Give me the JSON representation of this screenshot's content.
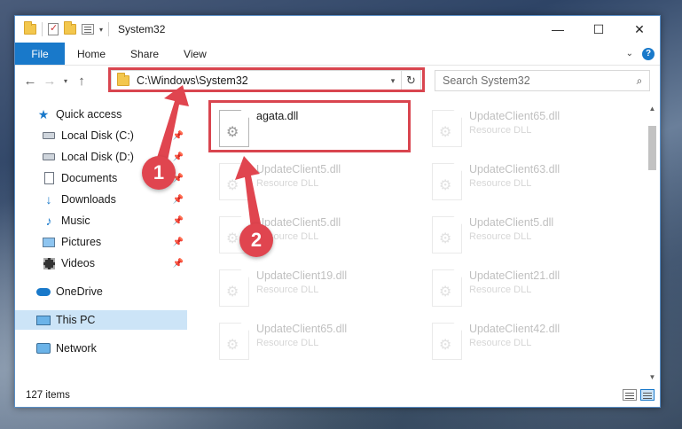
{
  "window": {
    "title": "System32",
    "controls": {
      "minimize": "—",
      "maximize": "☐",
      "close": "✕"
    }
  },
  "ribbon": {
    "tabs": [
      {
        "label": "File",
        "active": true
      },
      {
        "label": "Home"
      },
      {
        "label": "Share"
      },
      {
        "label": "View"
      }
    ],
    "expand_icon": "chevron-down-icon",
    "help_icon": "?"
  },
  "nav": {
    "back": "←",
    "forward": "→",
    "recent": "▾",
    "up": "↑",
    "address": "C:\\Windows\\System32",
    "address_dropdown": "▾",
    "refresh": "↻",
    "search_placeholder": "Search System32",
    "search_icon": "⌕"
  },
  "sidebar": {
    "items": [
      {
        "label": "Quick access",
        "icon": "star-icon",
        "level": "top",
        "pinned": false
      },
      {
        "label": "Local Disk (C:)",
        "icon": "disk-icon",
        "level": "sub",
        "pinned": true
      },
      {
        "label": "Local Disk (D:)",
        "icon": "disk-icon",
        "level": "sub",
        "pinned": true
      },
      {
        "label": "Documents",
        "icon": "document-icon",
        "level": "sub",
        "pinned": true
      },
      {
        "label": "Downloads",
        "icon": "download-icon",
        "level": "sub",
        "pinned": true
      },
      {
        "label": "Music",
        "icon": "music-icon",
        "level": "sub",
        "pinned": true
      },
      {
        "label": "Pictures",
        "icon": "pictures-icon",
        "level": "sub",
        "pinned": true
      },
      {
        "label": "Videos",
        "icon": "videos-icon",
        "level": "sub",
        "pinned": true
      },
      {
        "label": "OneDrive",
        "icon": "cloud-icon",
        "level": "top",
        "pinned": false
      },
      {
        "label": "This PC",
        "icon": "computer-icon",
        "level": "top",
        "pinned": false,
        "selected": true
      },
      {
        "label": "Network",
        "icon": "network-icon",
        "level": "top",
        "pinned": false
      }
    ],
    "pin_glyph": "📌"
  },
  "files": [
    {
      "name": "agata.dll",
      "type": "",
      "faded": false
    },
    {
      "name": "UpdateClient65.dll",
      "type": "Resource DLL",
      "faded": true
    },
    {
      "name": "UpdateClient5.dll",
      "type": "Resource DLL",
      "faded": true
    },
    {
      "name": "UpdateClient63.dll",
      "type": "Resource DLL",
      "faded": true
    },
    {
      "name": "UpdateClient5.dll",
      "type": "Resource DLL",
      "faded": true
    },
    {
      "name": "UpdateClient5.dll",
      "type": "Resource DLL",
      "faded": true
    },
    {
      "name": "UpdateClient19.dll",
      "type": "Resource DLL",
      "faded": true
    },
    {
      "name": "UpdateClient21.dll",
      "type": "Resource DLL",
      "faded": true
    },
    {
      "name": "UpdateClient65.dll",
      "type": "Resource DLL",
      "faded": true
    },
    {
      "name": "UpdateClient42.dll",
      "type": "Resource DLL",
      "faded": true
    }
  ],
  "status": {
    "item_count": "127 items"
  },
  "annotations": {
    "badge1": "1",
    "badge2": "2",
    "color": "#e0454f"
  },
  "colors": {
    "accent": "#1979ca",
    "selection": "#cce4f7"
  }
}
